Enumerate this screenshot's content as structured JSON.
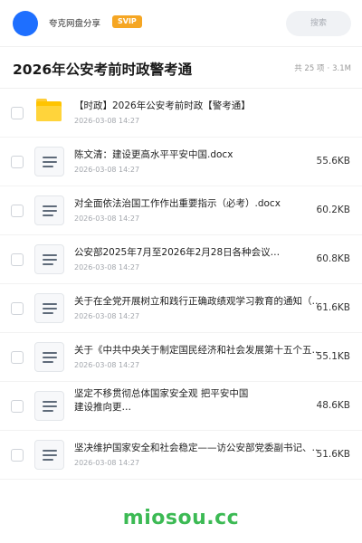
{
  "header": {
    "share_name": "夸克网盘分享",
    "badge": "SVIP",
    "search_placeholder": "搜索",
    "avatar_color": "#1e6fff"
  },
  "title_bar": {
    "title": "2026年公安考前时政警考通",
    "count": "共 25 项",
    "total_size": "3.1M"
  },
  "files": [
    {
      "type": "folder",
      "icon": "folder-icon",
      "name": "【时政】2026年公安考前时政【警考通】",
      "date": "2026-03-08 14:27",
      "size": ""
    },
    {
      "type": "doc",
      "icon": "document-icon",
      "name": "陈文清：建设更高水平平安中国.docx",
      "date": "2026-03-08 14:27",
      "size": "55.6KB"
    },
    {
      "type": "doc",
      "icon": "document-icon",
      "name": "对全面依法治国工作作出重要指示（必考）.docx",
      "date": "2026-03-08 14:27",
      "size": "60.2KB"
    },
    {
      "type": "doc",
      "icon": "document-icon",
      "name": "公安部2025年7月至2026年2月28日各种会议…",
      "date": "2026-03-08 14:27",
      "size": "60.8KB"
    },
    {
      "type": "doc",
      "icon": "document-icon",
      "name": "关于在全党开展树立和践行正确政绩观学习教育的通知（…",
      "date": "2026-03-08 14:27",
      "size": "61.6KB"
    },
    {
      "type": "doc",
      "icon": "document-icon",
      "name": "关于《中共中央关于制定国民经济和社会发展第十五个五…",
      "date": "2026-03-08 14:27",
      "size": "55.1KB"
    },
    {
      "type": "doc",
      "icon": "document-icon",
      "name": "坚定不移贯彻总体国家安全观 把平安中国建设推向更…",
      "date": "",
      "size": "48.6KB"
    },
    {
      "type": "doc",
      "icon": "document-icon",
      "name": "坚决维护国家安全和社会稳定——访公安部党委副书记、…",
      "date": "2026-03-08 14:27",
      "size": "51.6KB"
    }
  ],
  "footer": {
    "watermark": "miosou.cc",
    "color": "#3cba54"
  }
}
